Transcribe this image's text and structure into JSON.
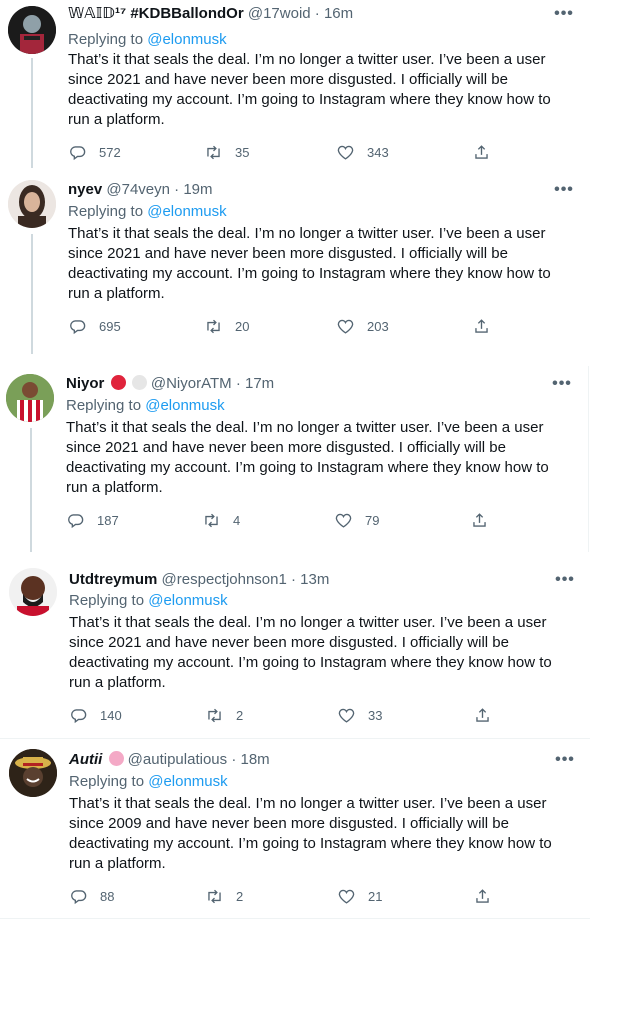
{
  "tweets": [
    {
      "name": "𝕎𝔸𝕀𝔻¹⁷ #KDBBallondOr",
      "handle": "@17woid",
      "time": "· 16m",
      "replying_label": "Replying to",
      "mention": "@elonmusk",
      "text": "That’s it that seals the deal. I’m no longer a twitter user. I’ve been a user since 2021 and have never been more disgusted. I officially will be deactivating my account. I’m going to Instagram where they know how to run a platform.",
      "replies": "572",
      "retweets": "35",
      "likes": "343"
    },
    {
      "name": "nyev",
      "handle": "@74veyn",
      "time": "· 19m",
      "replying_label": "Replying to",
      "mention": "@elonmusk",
      "text": "That’s it that seals the deal. I’m no longer a twitter user. I’ve been a user since 2021 and have never been more disgusted. I officially will be deactivating my account. I’m going to Instagram where they know how to run a platform.",
      "replies": "695",
      "retweets": "20",
      "likes": "203"
    },
    {
      "name": "Niyor",
      "handle": "@NiyorATM",
      "time": "· 17m",
      "replying_label": "Replying to",
      "mention": "@elonmusk",
      "text": "That’s it that seals the deal. I’m no longer a twitter user. I’ve been a user since 2021 and have never been more disgusted. I officially will be deactivating my account. I’m going to Instagram where they know how to run a platform.",
      "replies": "187",
      "retweets": "4",
      "likes": "79"
    },
    {
      "name": "Utdtreymum",
      "handle": "@respectjohnson1",
      "time": "· 13m",
      "replying_label": "Replying to",
      "mention": "@elonmusk",
      "text": "That’s it that seals the deal. I’m no longer a twitter user. I’ve been a user since 2021 and have never been more disgusted. I officially will be deactivating my account. I’m going to Instagram where they know how to run a platform.",
      "replies": "140",
      "retweets": "2",
      "likes": "33"
    },
    {
      "name": "Autii",
      "handle": "@autipulatious",
      "time": "· 18m",
      "replying_label": "Replying to",
      "mention": "@elonmusk",
      "text": "That’s it that seals the deal. I’m no longer a twitter user. I’ve been a user since 2009 and have never been more disgusted. I officially will be deactivating my account. I’m going to Instagram where they know how to run a platform.",
      "replies": "88",
      "retweets": "2",
      "likes": "21"
    }
  ],
  "icons": {
    "reply": "reply-icon",
    "retweet": "retweet-icon",
    "like": "heart-icon",
    "share": "share-icon",
    "more": "more-icon"
  },
  "colors": {
    "link": "#1d9bf0",
    "secondary_text": "#536471",
    "primary_text": "#0f1419",
    "niyor_badge_red": "#e0243c",
    "niyor_badge_white": "#e6e6e6",
    "autii_badge_pink": "#f4a9c6"
  }
}
